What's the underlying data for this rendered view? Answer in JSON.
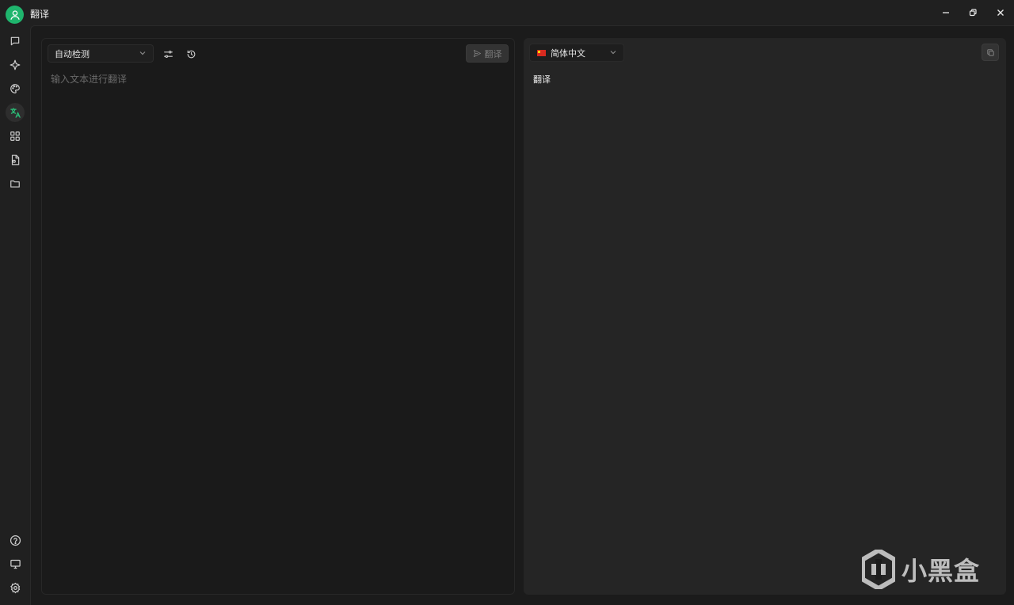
{
  "window": {
    "title": "翻译",
    "controls": [
      "minimize-icon",
      "restore-icon",
      "close-icon"
    ]
  },
  "sidebar": {
    "top_items": [
      {
        "name": "chat",
        "icon": "chat-bubble-icon"
      },
      {
        "name": "assistant",
        "icon": "sparkle-icon"
      },
      {
        "name": "paint",
        "icon": "palette-icon"
      },
      {
        "name": "translate",
        "icon": "translate-icon",
        "active": true
      },
      {
        "name": "apps",
        "icon": "grid-icon"
      },
      {
        "name": "files",
        "icon": "file-icon"
      },
      {
        "name": "folder",
        "icon": "folder-icon"
      }
    ],
    "bottom_items": [
      {
        "name": "help",
        "icon": "help-icon"
      },
      {
        "name": "display",
        "icon": "monitor-icon"
      },
      {
        "name": "settings",
        "icon": "gear-icon"
      }
    ]
  },
  "source": {
    "language": "自动检测",
    "placeholder": "输入文本进行翻译",
    "translate_button": "翻译"
  },
  "target": {
    "language": "简体中文",
    "output": "翻译"
  },
  "watermark": {
    "text": "小黑盒"
  },
  "colors": {
    "accent": "#1fb56d",
    "background": "#1b1b1b",
    "panel_right": "#252525"
  }
}
